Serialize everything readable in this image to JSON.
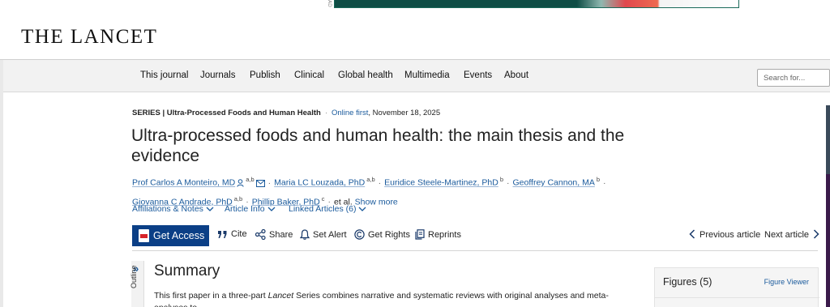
{
  "ad": {
    "tiny_label": "AD"
  },
  "header": {
    "logo": "THE LANCET"
  },
  "nav": {
    "items": [
      "This journal",
      "Journals",
      "Publish",
      "Clinical",
      "Global health",
      "Multimedia",
      "Events",
      "About"
    ],
    "search_placeholder": "Search for..."
  },
  "article": {
    "series_label": "SERIES | Ultra-Processed Foods and Human Health",
    "online_first": "Online first",
    "date": ", November 18, 2025",
    "title": "Ultra-processed foods and human health: the main thesis and the evidence",
    "authors": [
      {
        "name": "Prof Carlos A Monteiro, MD",
        "sup": "a,b"
      },
      {
        "name": "Maria LC Louzada, PhD",
        "sup": "a,b"
      },
      {
        "name": "Euridice Steele-Martinez, PhD",
        "sup": "b"
      },
      {
        "name": "Geoffrey Cannon, MA",
        "sup": "b"
      },
      {
        "name": "Giovanna C Andrade, PhD",
        "sup": "a,b"
      },
      {
        "name": "Phillip Baker, PhD",
        "sup": "c"
      }
    ],
    "et_al": "et al.",
    "show_more": "Show more",
    "meta_links": [
      "Affiliations & Notes",
      "Article Info",
      "Linked Articles (6)"
    ]
  },
  "toolbar": {
    "get_access": "Get Access",
    "cite": "Cite",
    "share": "Share",
    "set_alert": "Set Alert",
    "get_rights": "Get Rights",
    "reprints": "Reprints",
    "previous": "Previous article",
    "next": "Next article"
  },
  "content": {
    "outline_label": "Outline",
    "summary_heading": "Summary",
    "summary_pre": "This first paper in a three-part ",
    "summary_journal": "Lancet",
    "summary_post": " Series combines narrative and systematic reviews with original analyses and meta-analyses to"
  },
  "figures": {
    "title": "Figures (5)",
    "viewer": "Figure Viewer"
  },
  "colors": {
    "brand_blue": "#0b3f86",
    "link_blue": "#1a5a9c"
  }
}
